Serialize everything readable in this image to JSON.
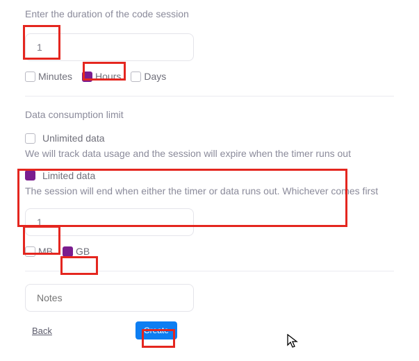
{
  "duration": {
    "label": "Enter the duration of the code session",
    "value": "1",
    "units": {
      "minutes": "Minutes",
      "hours": "Hours",
      "days": "Days"
    }
  },
  "data_limit": {
    "heading": "Data consumption limit",
    "unlimited": {
      "title": "Unlimited data",
      "desc": "We will track data usage and the session will expire when the timer runs out"
    },
    "limited": {
      "title": "Limited data",
      "desc": "The session will end when either the timer or data runs out. Whichever comes first"
    },
    "amount_value": "1",
    "units": {
      "mb": "MB",
      "gb": "GB"
    }
  },
  "notes": {
    "placeholder": "Notes"
  },
  "footer": {
    "back": "Back",
    "create": "Create"
  }
}
